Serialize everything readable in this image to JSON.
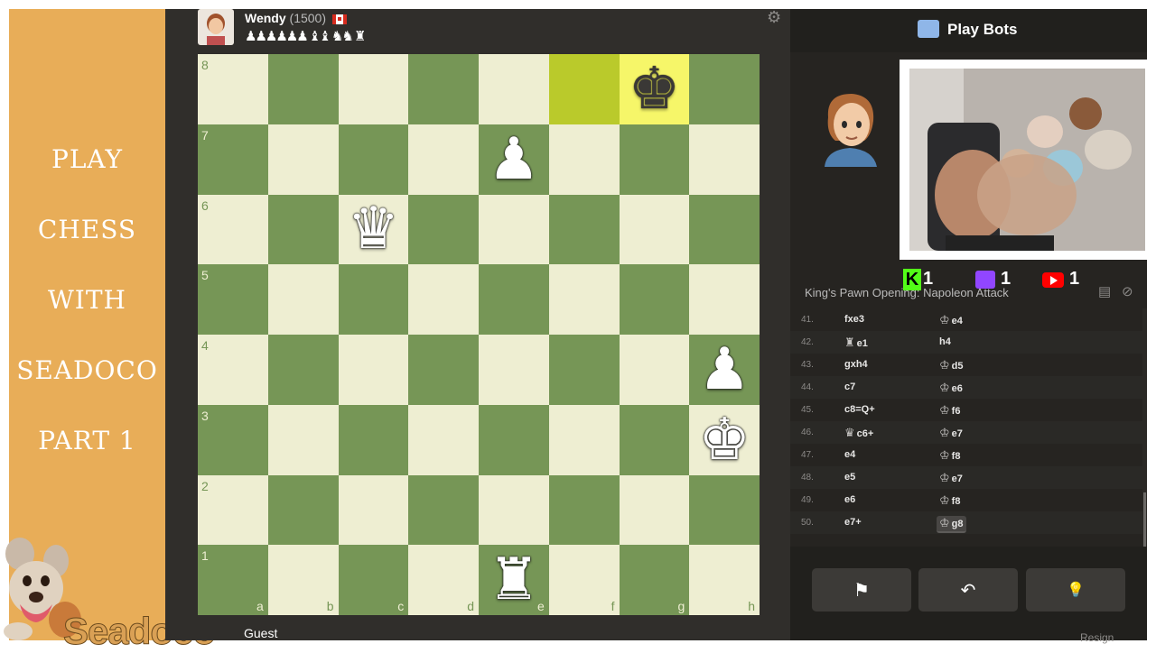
{
  "promo": {
    "lines": [
      "PLAY",
      "CHESS",
      "WITH",
      "SEADOCO",
      "PART 1"
    ],
    "brand": "Seadoco"
  },
  "top_player": {
    "name": "Wendy",
    "rating": "(1500)",
    "captured": "♟♟♟♟♟♟ ♝♝ ♞♞ ♜"
  },
  "bottom_player": {
    "name": "Guest"
  },
  "board": {
    "ranks": [
      "8",
      "7",
      "6",
      "5",
      "4",
      "3",
      "2",
      "1"
    ],
    "files": [
      "a",
      "b",
      "c",
      "d",
      "e",
      "f",
      "g",
      "h"
    ],
    "pieces": {
      "g8": {
        "glyph": "♚",
        "color": "b"
      },
      "e7": {
        "glyph": "♟",
        "color": "w"
      },
      "c6": {
        "glyph": "♛",
        "color": "w"
      },
      "h4": {
        "glyph": "♟",
        "color": "w"
      },
      "h3": {
        "glyph": "♚",
        "color": "w"
      },
      "e1": {
        "glyph": "♜",
        "color": "w"
      }
    },
    "highlighted": [
      "f8",
      "g8"
    ]
  },
  "panel": {
    "title": "Play Bots",
    "opening": "King's Pawn Opening: Napoleon Attack",
    "social": {
      "kick": "1",
      "twitch": "1",
      "youtube": "1",
      "kick_letter": "K"
    }
  },
  "moves": [
    {
      "num": "41.",
      "white": "fxe3",
      "white_fig": "",
      "black": "e4",
      "black_fig": "♔"
    },
    {
      "num": "42.",
      "white": "e1",
      "white_fig": "♜",
      "black": "h4",
      "black_fig": ""
    },
    {
      "num": "43.",
      "white": "gxh4",
      "white_fig": "",
      "black": "d5",
      "black_fig": "♔"
    },
    {
      "num": "44.",
      "white": "c7",
      "white_fig": "",
      "black": "e6",
      "black_fig": "♔"
    },
    {
      "num": "45.",
      "white": "c8=Q+",
      "white_fig": "",
      "black": "f6",
      "black_fig": "♔"
    },
    {
      "num": "46.",
      "white": "c6+",
      "white_fig": "♛",
      "black": "e7",
      "black_fig": "♔"
    },
    {
      "num": "47.",
      "white": "e4",
      "white_fig": "",
      "black": "f8",
      "black_fig": "♔"
    },
    {
      "num": "48.",
      "white": "e5",
      "white_fig": "",
      "black": "e7",
      "black_fig": "♔"
    },
    {
      "num": "49.",
      "white": "e6",
      "white_fig": "",
      "black": "f8",
      "black_fig": "♔"
    },
    {
      "num": "50.",
      "white": "e7+",
      "white_fig": "",
      "black": "g8",
      "black_fig": "♔"
    }
  ],
  "controls": {
    "flag": "⚑",
    "back": "↶",
    "hint": "💡",
    "resign": "Resign"
  },
  "colors": {
    "board_light": "#eeeed2",
    "board_dark": "#769656",
    "highlight_light": "#f6f669",
    "highlight_dark": "#baca2b",
    "promo_bg": "#e8ad58",
    "panel_bg": "#262421"
  }
}
